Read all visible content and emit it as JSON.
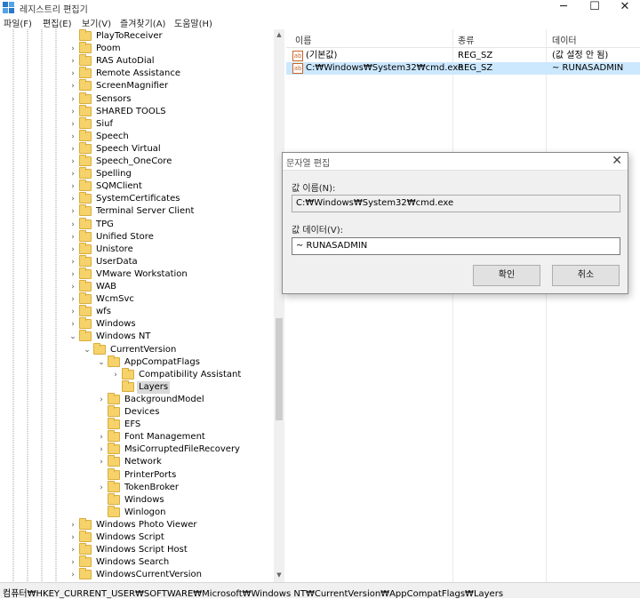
{
  "window": {
    "title": "레지스트리 편집기"
  },
  "menu": [
    "파일(F)",
    "편집(E)",
    "보기(V)",
    "즐겨찾기(A)",
    "도움말(H)"
  ],
  "tree": [
    {
      "label": "PlayToReceiver",
      "expander": "",
      "level": 0
    },
    {
      "label": "Poom",
      "expander": ">",
      "level": 0
    },
    {
      "label": "RAS AutoDial",
      "expander": ">",
      "level": 0
    },
    {
      "label": "Remote Assistance",
      "expander": ">",
      "level": 0
    },
    {
      "label": "ScreenMagnifier",
      "expander": ">",
      "level": 0
    },
    {
      "label": "Sensors",
      "expander": ">",
      "level": 0
    },
    {
      "label": "SHARED TOOLS",
      "expander": ">",
      "level": 0
    },
    {
      "label": "Siuf",
      "expander": ">",
      "level": 0
    },
    {
      "label": "Speech",
      "expander": ">",
      "level": 0
    },
    {
      "label": "Speech Virtual",
      "expander": ">",
      "level": 0
    },
    {
      "label": "Speech_OneCore",
      "expander": ">",
      "level": 0
    },
    {
      "label": "Spelling",
      "expander": ">",
      "level": 0
    },
    {
      "label": "SQMClient",
      "expander": ">",
      "level": 0
    },
    {
      "label": "SystemCertificates",
      "expander": ">",
      "level": 0
    },
    {
      "label": "Terminal Server Client",
      "expander": ">",
      "level": 0
    },
    {
      "label": "TPG",
      "expander": ">",
      "level": 0
    },
    {
      "label": "Unified Store",
      "expander": ">",
      "level": 0
    },
    {
      "label": "Unistore",
      "expander": ">",
      "level": 0
    },
    {
      "label": "UserData",
      "expander": ">",
      "level": 0
    },
    {
      "label": "VMware Workstation",
      "expander": ">",
      "level": 0
    },
    {
      "label": "WAB",
      "expander": ">",
      "level": 0
    },
    {
      "label": "WcmSvc",
      "expander": ">",
      "level": 0
    },
    {
      "label": "wfs",
      "expander": ">",
      "level": 0
    },
    {
      "label": "Windows",
      "expander": ">",
      "level": 0
    },
    {
      "label": "Windows NT",
      "expander": "v",
      "level": 0
    },
    {
      "label": "CurrentVersion",
      "expander": "v",
      "level": 1
    },
    {
      "label": "AppCompatFlags",
      "expander": "v",
      "level": 2
    },
    {
      "label": "Compatibility Assistant",
      "expander": ">",
      "level": 3
    },
    {
      "label": "Layers",
      "expander": "",
      "level": 3,
      "selected": true
    },
    {
      "label": "BackgroundModel",
      "expander": ">",
      "level": 2
    },
    {
      "label": "Devices",
      "expander": "",
      "level": 2
    },
    {
      "label": "EFS",
      "expander": "",
      "level": 2
    },
    {
      "label": "Font Management",
      "expander": ">",
      "level": 2
    },
    {
      "label": "MsiCorruptedFileRecovery",
      "expander": ">",
      "level": 2
    },
    {
      "label": "Network",
      "expander": ">",
      "level": 2
    },
    {
      "label": "PrinterPorts",
      "expander": "",
      "level": 2
    },
    {
      "label": "TokenBroker",
      "expander": ">",
      "level": 2
    },
    {
      "label": "Windows",
      "expander": "",
      "level": 2
    },
    {
      "label": "Winlogon",
      "expander": "",
      "level": 2
    },
    {
      "label": "Windows Photo Viewer",
      "expander": ">",
      "level": 0
    },
    {
      "label": "Windows Script",
      "expander": ">",
      "level": 0
    },
    {
      "label": "Windows Script Host",
      "expander": ">",
      "level": 0
    },
    {
      "label": "Windows Search",
      "expander": ">",
      "level": 0
    },
    {
      "label": "WindowsCurrentVersion",
      "expander": ">",
      "level": 0
    }
  ],
  "list": {
    "columns": [
      "이름",
      "종류",
      "데이터"
    ],
    "rows": [
      {
        "icon": "ab",
        "name": "(기본값)",
        "type": "REG_SZ",
        "data": "(값 설정 안 됨)",
        "selected": false
      },
      {
        "icon": "ab",
        "name": "C:₩Windows₩System32₩cmd.exe",
        "type": "REG_SZ",
        "data": "~ RUNASADMIN",
        "selected": true
      }
    ]
  },
  "dialog": {
    "title": "문자열 편집",
    "name_label": "값 이름(N):",
    "name_value": "C:₩Windows₩System32₩cmd.exe",
    "data_label": "값 데이터(V):",
    "data_value": "~ RUNASADMIN",
    "ok_label": "확인",
    "cancel_label": "취소"
  },
  "status": {
    "path": "컴퓨터₩HKEY_CURRENT_USER₩SOFTWARE₩Microsoft₩Windows NT₩CurrentVersion₩AppCompatFlags₩Layers"
  },
  "colors": {
    "selection_row": "#cce8ff",
    "folder": "#f6d26b"
  }
}
